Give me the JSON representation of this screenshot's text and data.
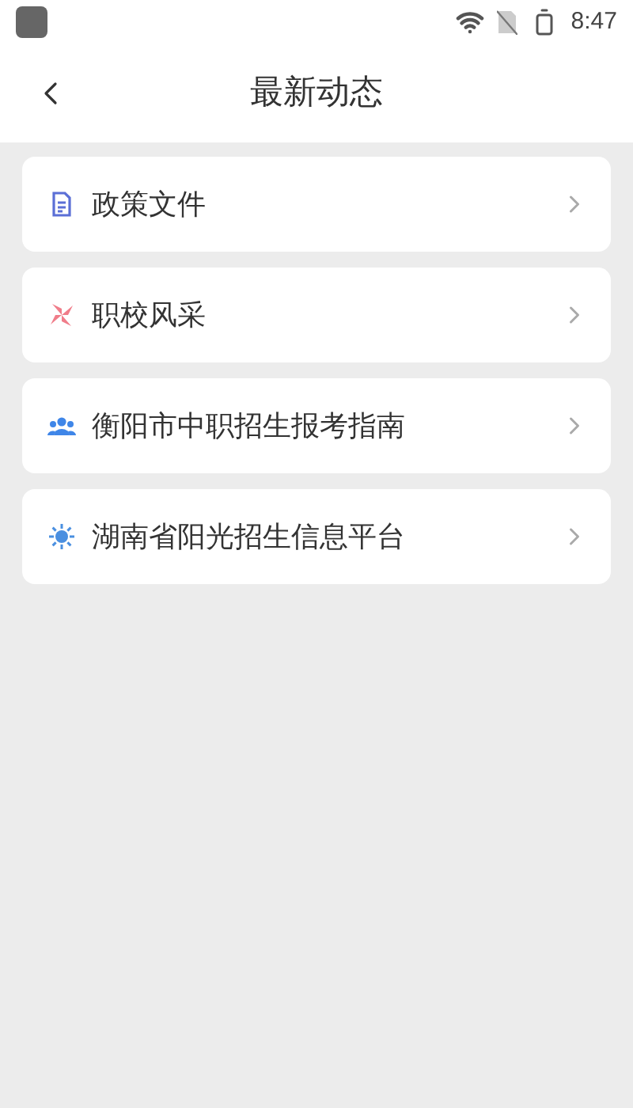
{
  "status_bar": {
    "time": "8:47"
  },
  "header": {
    "title": "最新动态"
  },
  "items": [
    {
      "label": "政策文件",
      "kind": "document"
    },
    {
      "label": "职校风采",
      "kind": "pinwheel"
    },
    {
      "label": "衡阳市中职招生报考指南",
      "kind": "people"
    },
    {
      "label": "湖南省阳光招生信息平台",
      "kind": "sun"
    }
  ]
}
